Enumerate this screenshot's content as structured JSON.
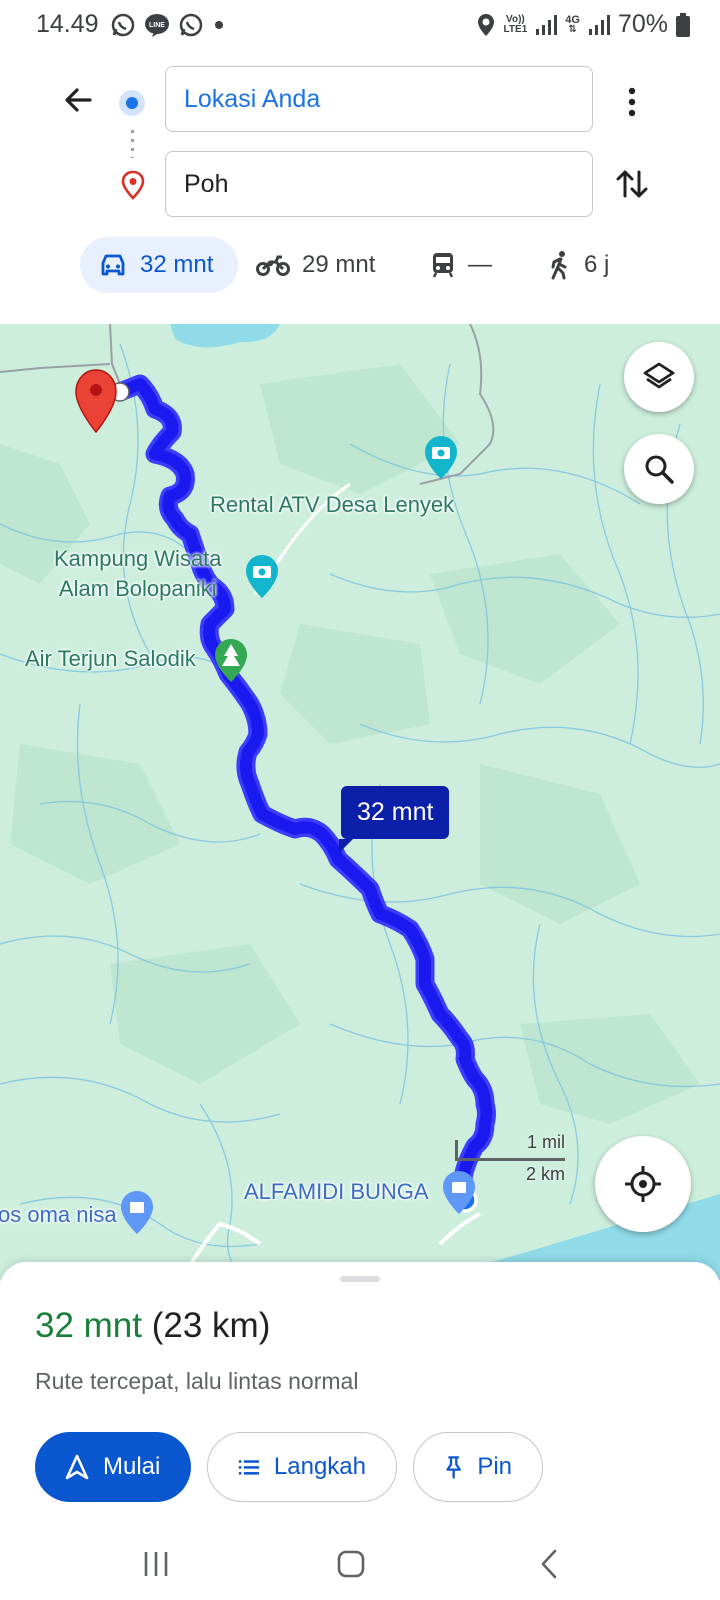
{
  "status_bar": {
    "time": "14.49",
    "volte": "Vo))",
    "lte": "LTE1",
    "network": "4G",
    "battery": "70%"
  },
  "search": {
    "origin": "Lokasi Anda",
    "destination": "Poh"
  },
  "modes": [
    {
      "icon": "car-icon",
      "label": "32 mnt",
      "active": true
    },
    {
      "icon": "motorcycle-icon",
      "label": "29 mnt"
    },
    {
      "icon": "train-icon",
      "label": "—"
    },
    {
      "icon": "walk-icon",
      "label": "6 j"
    }
  ],
  "map": {
    "places": {
      "rental_atv": "Rental ATV Desa Lenyek",
      "kampung_line1": "Kampung Wisata",
      "kampung_line2": "Alam Bolopaniki",
      "air_terjun": "Air Terjun Salodik",
      "alfamidi": "ALFAMIDI BUNGA",
      "oma_nisa": "os oma nisa"
    },
    "route_duration": "32 mnt",
    "scale_imperial": "1 mil",
    "scale_metric": "2 km",
    "colors": {
      "route": "#1a1af0",
      "land": "#cdeedd",
      "water": "#8fdbe8",
      "label_bubble": "#0b1fa8"
    }
  },
  "sheet": {
    "duration": "32 mnt",
    "distance": "(23 km)",
    "description": "Rute tercepat, lalu lintas normal",
    "start_label": "Mulai",
    "steps_label": "Langkah",
    "pin_label": "Pin"
  }
}
